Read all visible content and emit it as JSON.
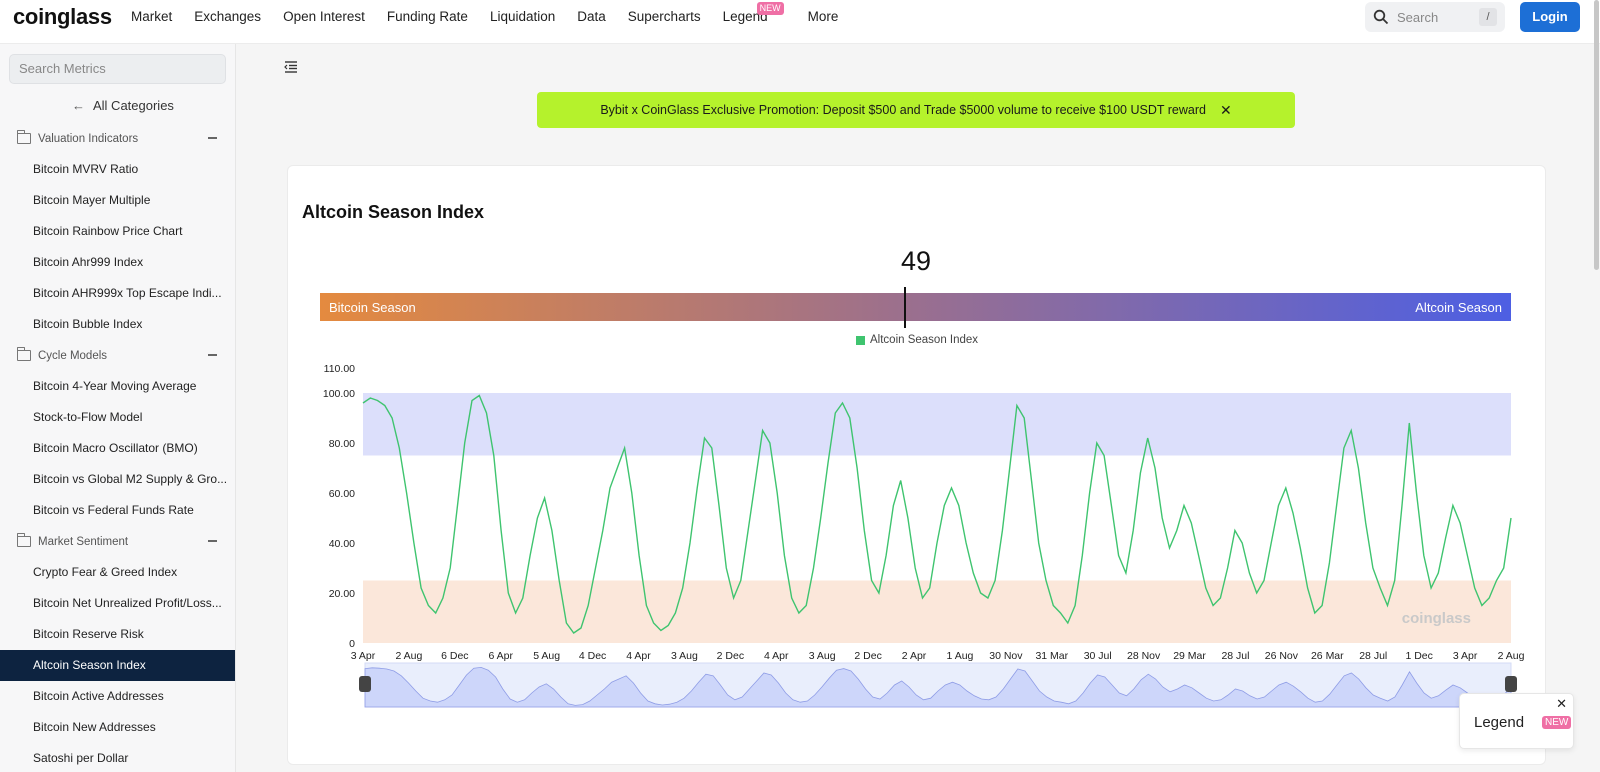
{
  "brand": "coinglass",
  "nav": {
    "items": [
      "Market",
      "Exchanges",
      "Open Interest",
      "Funding Rate",
      "Liquidation",
      "Data",
      "Supercharts",
      "Legend",
      "More"
    ],
    "legend_badge": "NEW"
  },
  "search": {
    "placeholder": "Search",
    "shortcut": "/"
  },
  "login_label": "Login",
  "sidebar": {
    "search_placeholder": "Search Metrics",
    "all_categories": "All Categories",
    "groups": [
      {
        "title": "Valuation Indicators",
        "items": [
          "Bitcoin MVRV Ratio",
          "Bitcoin Mayer Multiple",
          "Bitcoin Rainbow Price Chart",
          "Bitcoin Ahr999 Index",
          "Bitcoin AHR999x Top Escape Indi...",
          "Bitcoin Bubble Index"
        ]
      },
      {
        "title": "Cycle Models",
        "items": [
          "Bitcoin 4-Year Moving Average",
          "Stock-to-Flow Model",
          "Bitcoin Macro Oscillator (BMO)",
          "Bitcoin vs Global M2 Supply & Gro...",
          "Bitcoin vs Federal Funds Rate"
        ]
      },
      {
        "title": "Market Sentiment",
        "items": [
          "Crypto Fear & Greed Index",
          "Bitcoin Net Unrealized Profit/Loss...",
          "Bitcoin Reserve Risk",
          "Altcoin Season Index",
          "Bitcoin Active Addresses",
          "Bitcoin New Addresses",
          "Satoshi per Dollar"
        ]
      }
    ],
    "active_item": "Altcoin Season Index"
  },
  "promo": {
    "text": "Bybit x CoinGlass Exclusive Promotion: Deposit $500 and Trade $5000 volume to receive $100 USDT reward"
  },
  "chart": {
    "title": "Altcoin Season Index",
    "current_value": "49",
    "bar_left_label": "Bitcoin Season",
    "bar_right_label": "Altcoin Season",
    "legend_label": "Altcoin Season Index",
    "watermark": "coinglass"
  },
  "legend_popup": {
    "label": "Legend",
    "badge": "NEW"
  },
  "colors": {
    "series": "#3fc46f",
    "altcoin_zone": "#dcdffb",
    "bitcoin_zone": "#fbe7da",
    "accent": "#1d6fd6"
  },
  "chart_data": {
    "type": "line",
    "title": "Altcoin Season Index",
    "ylim": [
      0,
      110
    ],
    "yticks": [
      "0",
      "20.00",
      "40.00",
      "60.00",
      "80.00",
      "100.00",
      "110.00"
    ],
    "xticks": [
      "3 Apr",
      "2 Aug",
      "6 Dec",
      "6 Apr",
      "5 Aug",
      "4 Dec",
      "4 Apr",
      "3 Aug",
      "2 Dec",
      "4 Apr",
      "3 Aug",
      "2 Dec",
      "2 Apr",
      "1 Aug",
      "30 Nov",
      "31 Mar",
      "30 Jul",
      "28 Nov",
      "29 Mar",
      "28 Jul",
      "26 Nov",
      "26 Mar",
      "28 Jul",
      "1 Dec",
      "3 Apr",
      "2 Aug"
    ],
    "bands": [
      {
        "name": "Altcoin Season",
        "from": 75,
        "to": 100
      },
      {
        "name": "Bitcoin Season",
        "from": 0,
        "to": 25
      }
    ],
    "series": [
      {
        "name": "Altcoin Season Index",
        "values": [
          96,
          98,
          97,
          95,
          90,
          78,
          60,
          40,
          22,
          15,
          12,
          18,
          30,
          55,
          80,
          97,
          99,
          92,
          75,
          45,
          20,
          12,
          18,
          35,
          50,
          58,
          45,
          25,
          8,
          4,
          6,
          15,
          30,
          45,
          62,
          70,
          78,
          60,
          35,
          15,
          8,
          5,
          7,
          12,
          22,
          40,
          62,
          82,
          78,
          55,
          30,
          18,
          25,
          45,
          65,
          85,
          80,
          60,
          35,
          18,
          12,
          15,
          30,
          50,
          72,
          92,
          96,
          90,
          70,
          45,
          25,
          20,
          35,
          55,
          65,
          50,
          30,
          18,
          22,
          40,
          55,
          62,
          55,
          40,
          28,
          20,
          18,
          25,
          45,
          70,
          95,
          90,
          65,
          40,
          25,
          15,
          12,
          8,
          15,
          35,
          60,
          80,
          75,
          55,
          35,
          28,
          45,
          68,
          82,
          70,
          50,
          38,
          45,
          55,
          48,
          35,
          22,
          15,
          18,
          30,
          45,
          40,
          28,
          20,
          25,
          40,
          55,
          62,
          52,
          38,
          22,
          12,
          15,
          32,
          55,
          78,
          85,
          70,
          48,
          30,
          22,
          15,
          25,
          55,
          88,
          60,
          35,
          22,
          28,
          42,
          55,
          48,
          35,
          22,
          15,
          18,
          25,
          30,
          50
        ]
      }
    ]
  }
}
